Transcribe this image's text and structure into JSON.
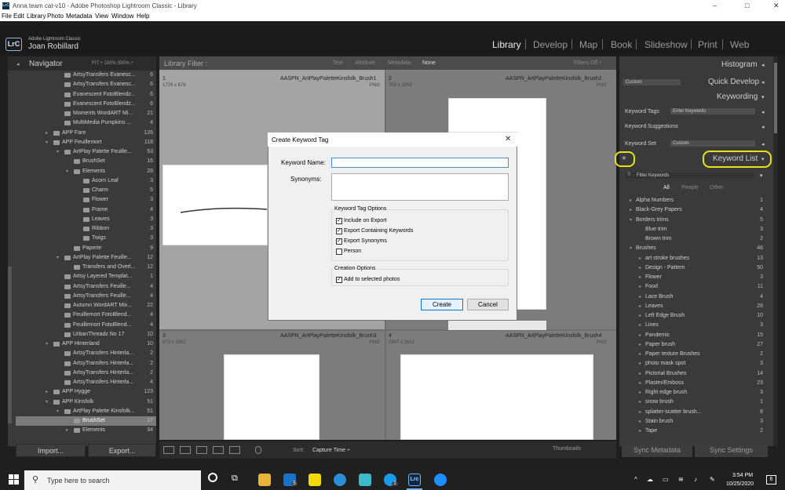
{
  "window": {
    "title": "Anna team cat-v10 - Adobe Photoshop Lightroom Classic - Library",
    "app_icon": "LrC",
    "controls": [
      "–",
      "□",
      "✕"
    ]
  },
  "menu": [
    "File",
    "Edit",
    "Library",
    "Photo",
    "Metadata",
    "View",
    "Window",
    "Help"
  ],
  "identity": {
    "logo": "LrC",
    "app_name": "Adobe Lightroom Classic",
    "user": "Joan Robillard"
  },
  "modules": [
    "Library",
    "Develop",
    "Map",
    "Book",
    "Slideshow",
    "Print",
    "Web"
  ],
  "navigator": {
    "title": "Navigator",
    "zoom": "FIT ÷   100%   300% ÷"
  },
  "folders": [
    {
      "label": "ArtsyTransfers Evanesc...",
      "count": "6",
      "indent": 2,
      "folder": true
    },
    {
      "label": "ArtsyTransfers Evanesc...",
      "count": "6",
      "indent": 2,
      "folder": true
    },
    {
      "label": "Evanescent FotoBlendz...",
      "count": "6",
      "indent": 2,
      "folder": true
    },
    {
      "label": "Evanescent FotoBlendz...",
      "count": "6",
      "indent": 2,
      "folder": true
    },
    {
      "label": "Moments WordART Mi...",
      "count": "21",
      "indent": 2,
      "folder": true
    },
    {
      "label": "MultiMedia Pumpkins ...",
      "count": "4",
      "indent": 2,
      "folder": true
    },
    {
      "label": "APP Fare",
      "count": "126",
      "indent": 1,
      "tri": "▸",
      "folder": true
    },
    {
      "label": "APP Feuillemort",
      "count": "118",
      "indent": 1,
      "tri": "▾",
      "folder": true
    },
    {
      "label": "ArtPlay Palette Feuille...",
      "count": "53",
      "indent": 2,
      "tri": "▾",
      "folder": true
    },
    {
      "label": "BrushSet",
      "count": "16",
      "indent": 3,
      "folder": true
    },
    {
      "label": "Elements",
      "count": "28",
      "indent": 3,
      "tri": "▾",
      "folder": true
    },
    {
      "label": "Acorn Leaf",
      "count": "3",
      "indent": 4,
      "folder": true
    },
    {
      "label": "Charm",
      "count": "5",
      "indent": 4,
      "folder": true
    },
    {
      "label": "Flower",
      "count": "3",
      "indent": 4,
      "folder": true
    },
    {
      "label": "Frame",
      "count": "4",
      "indent": 4,
      "folder": true
    },
    {
      "label": "Leaves",
      "count": "3",
      "indent": 4,
      "folder": true
    },
    {
      "label": "Ribbon",
      "count": "3",
      "indent": 4,
      "folder": true
    },
    {
      "label": "Twigs",
      "count": "3",
      "indent": 4,
      "folder": true
    },
    {
      "label": "Paperie",
      "count": "9",
      "indent": 3,
      "folder": true
    },
    {
      "label": "ArtPlay Palette Feuille...",
      "count": "12",
      "indent": 2,
      "tri": "▾",
      "folder": true
    },
    {
      "label": "Transfers and Overl...",
      "count": "12",
      "indent": 3,
      "folder": true
    },
    {
      "label": "Artsy Layered Templat...",
      "count": "1",
      "indent": 2,
      "folder": true
    },
    {
      "label": "ArtsyTransfers Feuille...",
      "count": "4",
      "indent": 2,
      "folder": true
    },
    {
      "label": "ArtsyTransfers Feuille...",
      "count": "4",
      "indent": 2,
      "folder": true
    },
    {
      "label": "Autumn WordART Mix...",
      "count": "22",
      "indent": 2,
      "folder": true
    },
    {
      "label": "Feuillemort FotoBlend...",
      "count": "4",
      "indent": 2,
      "folder": true
    },
    {
      "label": "Feuillemort FotoBlend...",
      "count": "4",
      "indent": 2,
      "folder": true
    },
    {
      "label": "UrbanThreadz No 17",
      "count": "10",
      "indent": 2,
      "folder": true
    },
    {
      "label": "APP Hinterland",
      "count": "10",
      "indent": 1,
      "tri": "▾",
      "folder": true
    },
    {
      "label": "ArtsyTransfers Hinterla...",
      "count": "2",
      "indent": 2,
      "folder": true
    },
    {
      "label": "ArtsyTransfers Hinterla...",
      "count": "2",
      "indent": 2,
      "folder": true
    },
    {
      "label": "ArtsyTransfers Hinterla...",
      "count": "2",
      "indent": 2,
      "folder": true
    },
    {
      "label": "ArtsyTransfers Hinterla...",
      "count": "4",
      "indent": 2,
      "folder": true
    },
    {
      "label": "APP Hygge",
      "count": "123",
      "indent": 1,
      "tri": "▸",
      "folder": true
    },
    {
      "label": "APP Kinsfolk",
      "count": "51",
      "indent": 1,
      "tri": "▾",
      "folder": true
    },
    {
      "label": "ArtPlay Palette Kinsfolk...",
      "count": "51",
      "indent": 2,
      "tri": "▾",
      "folder": true
    },
    {
      "label": "BrushSet",
      "count": "17",
      "indent": 3,
      "selected": true,
      "folder": true
    },
    {
      "label": "Elements",
      "count": "34",
      "indent": 3,
      "tri": "▸",
      "folder": true
    }
  ],
  "left_buttons": {
    "import": "Import...",
    "export": "Export..."
  },
  "filter": {
    "title": "Library Filter :",
    "options": [
      "Text",
      "Attribute",
      "Metadata",
      "None"
    ],
    "active": "None",
    "filters_off": "Filters Off ÷"
  },
  "grid": [
    {
      "num": "1",
      "name": "AASPN_ArtPlayPaletteKinsfolk_Brush1",
      "dims": "1729 x 678",
      "type": "PNG"
    },
    {
      "num": "2",
      "name": "AASPN_ArtPlayPaletteKinsfolk_Brush2",
      "dims": "709 x 1563",
      "type": "PNG"
    },
    {
      "num": "3",
      "name": "AASPN_ArtPlayPaletteKinsfolk_Brush3",
      "dims": "873 x 1952",
      "type": "PNG"
    },
    {
      "num": "4",
      "name": "AASPN_ArtPlayPaletteKinsfolk_Brush4",
      "dims": "2347 x 2612",
      "type": "PNG"
    }
  ],
  "toolbar": {
    "sort_label": "Sort:",
    "sort_value": "Capture Time ÷",
    "thumbnails": "Thumbnails"
  },
  "right": {
    "histogram": "Histogram",
    "custom": "Custom",
    "quick_develop": "Quick Develop",
    "keywording": "Keywording",
    "keyword_tags_label": "Keyword Tags",
    "keyword_tags_value": "Enter Keywords",
    "keyword_suggestions": "Keyword Suggestions",
    "keyword_set_label": "Keyword Set",
    "keyword_set_value": "Custom",
    "keyword_list": "Keyword List",
    "add": "+",
    "filter_placeholder": "Filter Keywords",
    "tabs": [
      "All",
      "People",
      "Other"
    ],
    "sync_metadata": "Sync Metadata",
    "sync_settings": "Sync Settings"
  },
  "keywords": [
    {
      "label": "Alpha Numbers",
      "count": "1",
      "indent": 1,
      "tri": "▸"
    },
    {
      "label": "Black-Grey Papers",
      "count": "4",
      "indent": 1,
      "tri": "▸"
    },
    {
      "label": "Borders trims",
      "count": "5",
      "indent": 1,
      "tri": "▾"
    },
    {
      "label": "Blue trim",
      "count": "3",
      "indent": 2
    },
    {
      "label": "Brown trim",
      "count": "2",
      "indent": 2
    },
    {
      "label": "Brushes",
      "count": "46",
      "indent": 1,
      "tri": "▾"
    },
    {
      "label": "art stroke brushes",
      "count": "13",
      "indent": 2,
      "tri": "▸"
    },
    {
      "label": "Design - Pattern",
      "count": "50",
      "indent": 2,
      "tri": "▸"
    },
    {
      "label": "Flower",
      "count": "3",
      "indent": 2,
      "tri": "▸"
    },
    {
      "label": "Food",
      "count": "11",
      "indent": 2,
      "tri": "▸"
    },
    {
      "label": "Lace Brush",
      "count": "4",
      "indent": 2,
      "tri": "▸"
    },
    {
      "label": "Leaves",
      "count": "28",
      "indent": 2,
      "tri": "▸"
    },
    {
      "label": "Left Edge Brush",
      "count": "10",
      "indent": 2,
      "tri": "▸"
    },
    {
      "label": "Lines",
      "count": "3",
      "indent": 2,
      "tri": "▸"
    },
    {
      "label": "Pandemic",
      "count": "15",
      "indent": 2,
      "tri": "▸"
    },
    {
      "label": "Paper brush",
      "count": "27",
      "indent": 2,
      "tri": "▸"
    },
    {
      "label": "Paper texture Brushes",
      "count": "2",
      "indent": 2,
      "tri": "▸"
    },
    {
      "label": "photo mask spot",
      "count": "3",
      "indent": 2,
      "tri": "▸"
    },
    {
      "label": "Pictorial Brushes",
      "count": "14",
      "indent": 2,
      "tri": "▸"
    },
    {
      "label": "Plaster/Emboss",
      "count": "23",
      "indent": 2,
      "tri": "▸"
    },
    {
      "label": "Right edge brush",
      "count": "3",
      "indent": 2,
      "tri": "▸"
    },
    {
      "label": "snow brush",
      "count": "1",
      "indent": 2,
      "tri": "▸"
    },
    {
      "label": "splatter-scatter brush...",
      "count": "8",
      "indent": 2,
      "tri": "▸"
    },
    {
      "label": "Stain brush",
      "count": "3",
      "indent": 2,
      "tri": "▸"
    },
    {
      "label": "Tape",
      "count": "2",
      "indent": 2,
      "tri": "▸"
    }
  ],
  "dialog": {
    "title": "Create Keyword Tag",
    "close": "✕",
    "keyword_name_label": "Keyword Name:",
    "keyword_name_value": "",
    "synonyms_label": "Synonyms:",
    "tag_options_title": "Keyword Tag Options",
    "options": [
      {
        "label": "Include on Export",
        "checked": "✓"
      },
      {
        "label": "Export Containing Keywords",
        "checked": "✓"
      },
      {
        "label": "Export Synonyms",
        "checked": "✓"
      },
      {
        "label": "Person",
        "checked": ""
      }
    ],
    "creation_title": "Creation Options",
    "creation": [
      {
        "label": "Add to selected photos",
        "checked": "✓"
      }
    ],
    "create": "Create",
    "cancel": "Cancel"
  },
  "taskbar": {
    "search": "Type here to search",
    "time": "3:54 PM",
    "date": "10/25/2020",
    "notif": "6",
    "badge_mail": "5",
    "badge_skype": "1",
    "lrc": "Lrc"
  }
}
